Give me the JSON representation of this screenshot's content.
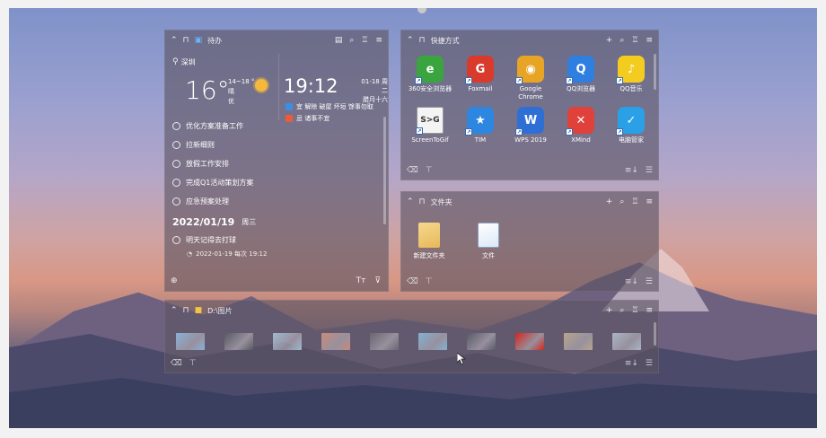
{
  "todo_panel": {
    "title": "待办",
    "weather": {
      "city": "深圳",
      "temperature": "16°",
      "temp_range": "14~18 °",
      "condition": "晴",
      "air_quality": "优"
    },
    "clock": {
      "time": "19:12",
      "date": "01-18 周二",
      "lunar": "腊月十六"
    },
    "almanac": {
      "good": "宜 解除 破屋 坏垣 馀事勿取",
      "bad": "忌 诸事不宜"
    },
    "todos": [
      "优化方案准备工作",
      "拉新细则",
      "放假工作安排",
      "完成Q1活动策划方案",
      "应急预案处理"
    ],
    "date_group": {
      "date": "2022/01/19",
      "weekday": "周三"
    },
    "dated_todo": {
      "text": "明天记得去打球",
      "reminder": "2022-01-19  每次 19:12"
    }
  },
  "shortcut_panel": {
    "title": "快捷方式",
    "apps": [
      {
        "name": "360安全浏览器",
        "icon": "360-browser-icon",
        "color": "#3aa53e",
        "glyph": "e"
      },
      {
        "name": "Foxmail",
        "icon": "foxmail-icon",
        "color": "#d93a2b",
        "glyph": "G"
      },
      {
        "name": "Google Chrome",
        "icon": "chrome-icon",
        "color": "#e8a425",
        "glyph": "◉"
      },
      {
        "name": "QQ浏览器",
        "icon": "qq-browser-icon",
        "color": "#2f7fe0",
        "glyph": "Q"
      },
      {
        "name": "QQ音乐",
        "icon": "qq-music-icon",
        "color": "#f3cc1f",
        "glyph": "♪"
      },
      {
        "name": "ScreenToGif",
        "icon": "screentogif-icon",
        "color": "#f4f4f4",
        "glyph": "S>G"
      },
      {
        "name": "TIM",
        "icon": "tim-icon",
        "color": "#2d86e0",
        "glyph": "★"
      },
      {
        "name": "WPS 2019",
        "icon": "wps-icon",
        "color": "#2e6fd6",
        "glyph": "W"
      },
      {
        "name": "XMind",
        "icon": "xmind-icon",
        "color": "#e0413a",
        "glyph": "✕"
      },
      {
        "name": "电脑管家",
        "icon": "pc-manager-icon",
        "color": "#2aa0e6",
        "glyph": "✓"
      }
    ]
  },
  "folder_panel": {
    "title": "文件夹",
    "files": [
      {
        "name": "新建文件夹",
        "type": "folder"
      },
      {
        "name": "文件",
        "type": "doc"
      }
    ]
  },
  "picture_panel": {
    "title": "D:\\图片",
    "thumbnails": [
      "#8ab0d6",
      "#5a5a62",
      "#9fb8d0",
      "#c98a7a",
      "#6a6770",
      "#7fb2d2",
      "#585a66",
      "#d3261c",
      "#b8a48c",
      "#a9b5c4"
    ]
  },
  "colors": {
    "accent_blue": "#3a8ee6",
    "panel_bg": "#5c5462",
    "sun": "#f5b83d"
  }
}
